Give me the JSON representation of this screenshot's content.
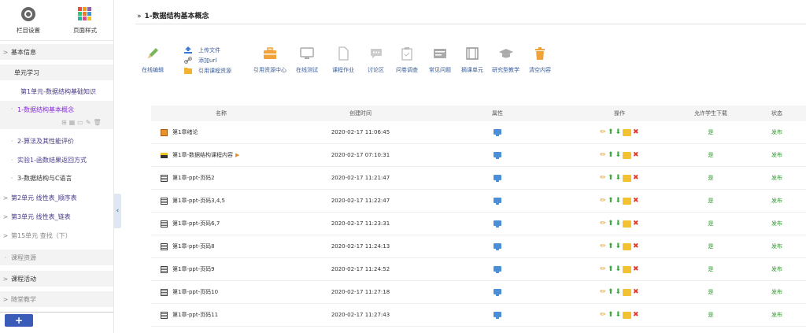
{
  "sidebar": {
    "top_tools": [
      {
        "label": "栏目设置"
      },
      {
        "label": "页面样式"
      }
    ],
    "items": [
      {
        "label": "基本信息"
      },
      {
        "label": "单元学习"
      },
      {
        "label": "第1单元-数据结构基础知识"
      },
      {
        "label": "1-数据结构基本概念"
      },
      {
        "label": "2-算法及其性能评价"
      },
      {
        "label": "实验1-函数结果返回方式"
      },
      {
        "label": "3-数据结构与C语言"
      },
      {
        "label": "第2单元 线性表_顺序表"
      },
      {
        "label": "第3单元 线性表_链表"
      },
      {
        "label": "第15单元 查找（下）"
      },
      {
        "label": "课程资源"
      },
      {
        "label": "课程活动"
      },
      {
        "label": "随堂教学"
      }
    ],
    "add_label": "+"
  },
  "page": {
    "arrows": "»",
    "title": "1-数据结构基本概念"
  },
  "toolbar": {
    "online_edit": "在线编辑",
    "upload": "上传文件",
    "add_url": "添加url",
    "cite_course": "引用课程资源",
    "buttons": [
      {
        "label": "引用资源中心"
      },
      {
        "label": "在线测试"
      },
      {
        "label": "课程作业"
      },
      {
        "label": "讨论区"
      },
      {
        "label": "问卷调查"
      },
      {
        "label": "常见问题"
      },
      {
        "label": "摘课单元"
      },
      {
        "label": "研究型教学"
      },
      {
        "label": "清空内容"
      }
    ]
  },
  "table": {
    "headers": {
      "name": "名称",
      "time": "创建时间",
      "attr": "属性",
      "ops": "操作",
      "download": "允许学生下载",
      "status": "状态"
    },
    "rows": [
      {
        "name": "第1章绪论",
        "time": "2020-02-17 11:06:45",
        "download": "是",
        "status": "发布"
      },
      {
        "name": "第1章-数据结构课程内容",
        "time": "2020-02-17 07:10:31",
        "download": "是",
        "status": "发布"
      },
      {
        "name": "第1章-ppt-页码2",
        "time": "2020-02-17 11:21:47",
        "download": "是",
        "status": "发布"
      },
      {
        "name": "第1章-ppt-页码3,4,5",
        "time": "2020-02-17 11:22:47",
        "download": "是",
        "status": "发布"
      },
      {
        "name": "第1章-ppt-页码6,7",
        "time": "2020-02-17 11:23:31",
        "download": "是",
        "status": "发布"
      },
      {
        "name": "第1章-ppt-页码8",
        "time": "2020-02-17 11:24:13",
        "download": "是",
        "status": "发布"
      },
      {
        "name": "第1章-ppt-页码9",
        "time": "2020-02-17 11:24:52",
        "download": "是",
        "status": "发布"
      },
      {
        "name": "第1章-ppt-页码10",
        "time": "2020-02-17 11:27:18",
        "download": "是",
        "status": "发布"
      },
      {
        "name": "第1章-ppt-页码11",
        "time": "2020-02-17 11:27:43",
        "download": "是",
        "status": "发布"
      }
    ]
  },
  "colors": {
    "accent": "#8a2be2",
    "link": "#3a5d9c",
    "status_green": "#2e9a2e",
    "add_button": "#3b5bb8"
  }
}
